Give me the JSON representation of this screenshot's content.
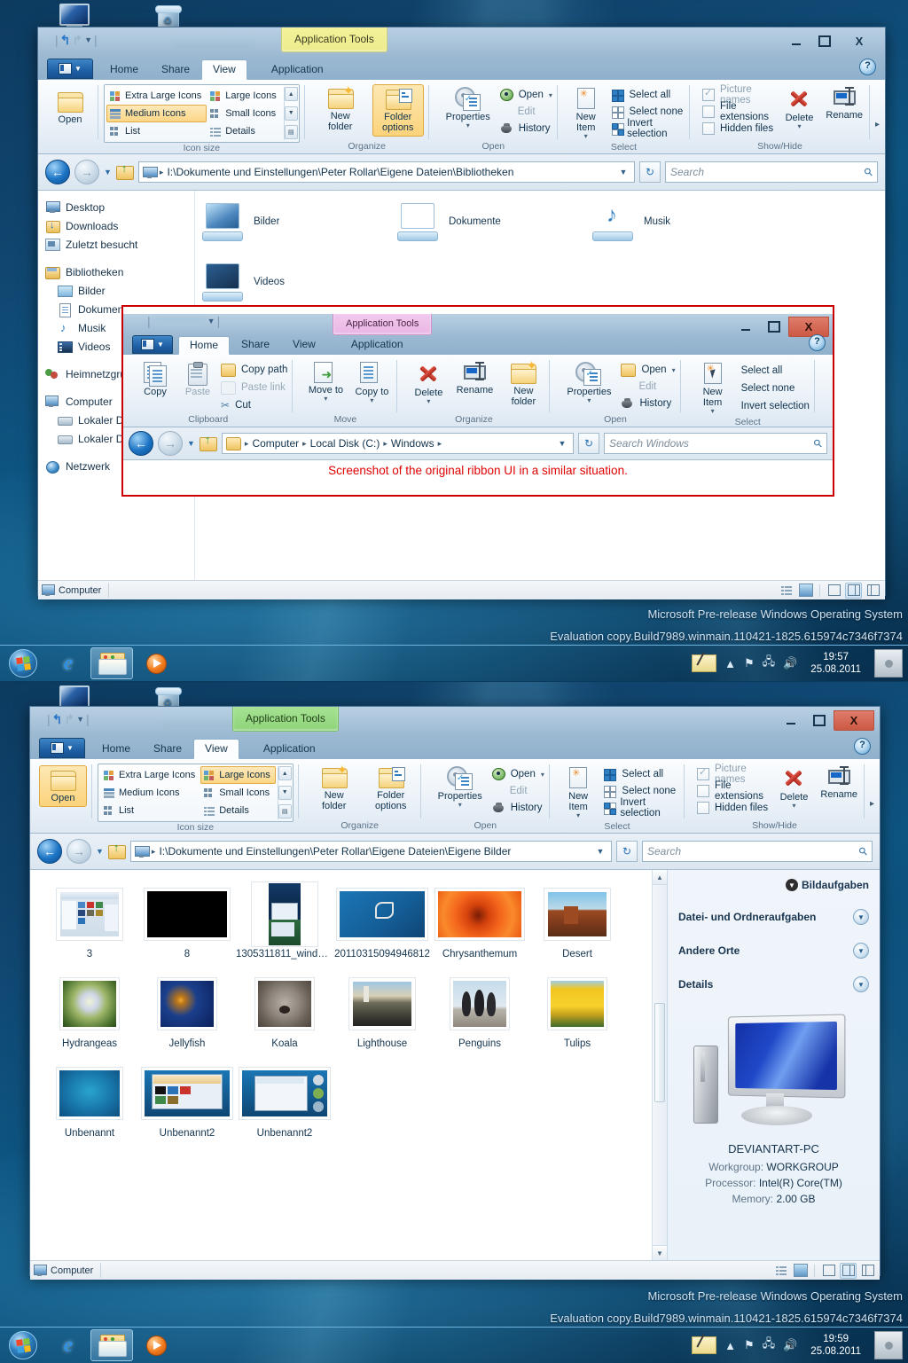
{
  "desktop": {
    "icons": [
      {
        "name": "Computer",
        "label": ""
      },
      {
        "name": "Recycle Bin",
        "label": ""
      }
    ],
    "watermark_line1": "Microsoft Pre-release Windows Operating System",
    "watermark_line2": "Evaluation copy.Build7989.winmain.110421-1825.615974c7346f7374"
  },
  "taskbar_top": {
    "start_label": "Start",
    "buttons": [
      "internet-explorer",
      "windows-explorer",
      "windows-media-player"
    ],
    "time": "19:57",
    "date": "25.08.2011"
  },
  "taskbar_bottom": {
    "start_label": "Start",
    "buttons": [
      "internet-explorer",
      "windows-explorer",
      "windows-media-player"
    ],
    "time": "19:59",
    "date": "25.08.2011"
  },
  "window_top": {
    "contextual_tab": "Application Tools",
    "contextual_tab_color": "#f0ee93",
    "tabs": [
      {
        "label": "Home",
        "selected": false
      },
      {
        "label": "Share",
        "selected": false
      },
      {
        "label": "View",
        "selected": true
      },
      {
        "label": "Application",
        "selected": false
      }
    ],
    "window_buttons": {
      "minimize": "–",
      "maximize": "□",
      "close": "X"
    },
    "help_tooltip": "Help",
    "ribbon": {
      "open_button": {
        "label": "Open",
        "highlighted": false
      },
      "groups": [
        {
          "title": "Icon size",
          "gallery": [
            {
              "label": "Extra Large Icons",
              "selected": false
            },
            {
              "label": "Medium Icons",
              "selected": true
            },
            {
              "label": "List",
              "selected": false
            },
            {
              "label": "Large Icons",
              "selected": false
            },
            {
              "label": "Small Icons",
              "selected": false
            },
            {
              "label": "Details",
              "selected": false
            }
          ]
        },
        {
          "title": "Organize",
          "buttons": [
            {
              "label": "New folder",
              "highlighted": false
            },
            {
              "label": "Folder options",
              "highlighted": true
            }
          ]
        },
        {
          "title": "Open",
          "buttons": [
            {
              "label": "Properties"
            }
          ],
          "small": [
            {
              "label": "Open"
            },
            {
              "label": "Edit",
              "disabled": true
            },
            {
              "label": "History"
            }
          ]
        },
        {
          "title": "Select",
          "buttons": [
            {
              "label": "New Item"
            }
          ],
          "small": [
            {
              "label": "Select all"
            },
            {
              "label": "Select none"
            },
            {
              "label": "Invert selection"
            }
          ]
        },
        {
          "title": "Show/Hide",
          "checkboxes": [
            {
              "label": "Picture names",
              "checked": true
            },
            {
              "label": "File extensions",
              "checked": false
            },
            {
              "label": "Hidden files",
              "checked": false
            }
          ],
          "buttons": [
            {
              "label": "Delete"
            },
            {
              "label": "Rename"
            }
          ]
        }
      ]
    },
    "address": "I:\\Dokumente und Einstellungen\\Peter Rollar\\Eigene Dateien\\Bibliotheken",
    "search_placeholder": "Search",
    "nav_pane": [
      {
        "label": "Desktop",
        "icon": "desktop-icon"
      },
      {
        "label": "Downloads",
        "icon": "downloads-icon"
      },
      {
        "label": "Zuletzt besucht",
        "icon": "recent-icon"
      },
      {
        "label": "Bibliotheken",
        "icon": "library-icon"
      },
      {
        "label": "Bilder",
        "icon": "pictures-icon"
      },
      {
        "label": "Dokumente",
        "icon": "documents-icon"
      },
      {
        "label": "Musik",
        "icon": "music-icon"
      },
      {
        "label": "Videos",
        "icon": "videos-icon"
      },
      {
        "label": "Heimnetzgruppe",
        "icon": "homegroup-icon"
      },
      {
        "label": "Computer",
        "icon": "computer-icon"
      },
      {
        "label": "Lokaler Datenträger",
        "icon": "drive-icon"
      },
      {
        "label": "Lokaler Datenträger",
        "icon": "drive-icon"
      },
      {
        "label": "Netzwerk",
        "icon": "network-icon"
      }
    ],
    "files": [
      {
        "name": "Bilder",
        "icon": "pictures-library"
      },
      {
        "name": "Dokumente",
        "icon": "documents-library"
      },
      {
        "name": "Musik",
        "icon": "music-library"
      },
      {
        "name": "Videos",
        "icon": "videos-library"
      }
    ],
    "status_text": "Computer"
  },
  "inset": {
    "caption": "Screenshot of the original ribbon UI in a similar situation.",
    "contextual_tab": "Application Tools",
    "tabs": [
      {
        "label": "Home",
        "selected": true
      },
      {
        "label": "Share",
        "selected": false
      },
      {
        "label": "View",
        "selected": false
      },
      {
        "label": "Application",
        "selected": false
      }
    ],
    "window_buttons": {
      "minimize": "–",
      "maximize": "□",
      "close": "X"
    },
    "groups": [
      {
        "title": "Clipboard",
        "big": [
          {
            "label": "Copy"
          },
          {
            "label": "Paste",
            "disabled": true
          }
        ],
        "small": [
          {
            "label": "Copy path",
            "disabled": false
          },
          {
            "label": "Paste link",
            "disabled": true
          },
          {
            "label": "Cut",
            "disabled": false
          }
        ]
      },
      {
        "title": "Move",
        "big": [
          {
            "label": "Move to"
          },
          {
            "label": "Copy to"
          }
        ]
      },
      {
        "title": "Organize",
        "big": [
          {
            "label": "Delete"
          },
          {
            "label": "Rename"
          },
          {
            "label": "New folder"
          }
        ]
      },
      {
        "title": "Open",
        "big": [
          {
            "label": "Properties"
          }
        ],
        "small": [
          {
            "label": "Open"
          },
          {
            "label": "Edit",
            "disabled": true
          },
          {
            "label": "History"
          }
        ]
      },
      {
        "title": "Select",
        "big": [
          {
            "label": "New Item"
          }
        ],
        "small": [
          {
            "label": "Select all"
          },
          {
            "label": "Select none"
          },
          {
            "label": "Invert selection"
          }
        ]
      }
    ],
    "breadcrumb": [
      "Computer",
      "Local Disk (C:)",
      "Windows"
    ],
    "search_placeholder": "Search Windows"
  },
  "window_bottom": {
    "contextual_tab": "Application Tools",
    "contextual_tab_color": "#93dc80",
    "tabs": [
      {
        "label": "Home",
        "selected": false
      },
      {
        "label": "Share",
        "selected": false
      },
      {
        "label": "View",
        "selected": true
      },
      {
        "label": "Application",
        "selected": false
      }
    ],
    "window_buttons": {
      "minimize": "–",
      "maximize": "□",
      "close": "X"
    },
    "ribbon": {
      "open_button": {
        "label": "Open",
        "highlighted": true
      },
      "groups": [
        {
          "title": "Icon size",
          "gallery": [
            {
              "label": "Extra Large Icons",
              "selected": false
            },
            {
              "label": "Medium Icons",
              "selected": false
            },
            {
              "label": "List",
              "selected": false
            },
            {
              "label": "Large Icons",
              "selected": true
            },
            {
              "label": "Small Icons",
              "selected": false
            },
            {
              "label": "Details",
              "selected": false
            }
          ]
        },
        {
          "title": "Organize",
          "buttons": [
            {
              "label": "New folder",
              "highlighted": false
            },
            {
              "label": "Folder options",
              "highlighted": false
            }
          ]
        },
        {
          "title": "Open",
          "buttons": [
            {
              "label": "Properties"
            }
          ],
          "small": [
            {
              "label": "Open"
            },
            {
              "label": "Edit",
              "disabled": true
            },
            {
              "label": "History"
            }
          ]
        },
        {
          "title": "Select",
          "buttons": [
            {
              "label": "New Item"
            }
          ],
          "small": [
            {
              "label": "Select all"
            },
            {
              "label": "Select none"
            },
            {
              "label": "Invert selection"
            }
          ]
        },
        {
          "title": "Show/Hide",
          "checkboxes": [
            {
              "label": "Picture names",
              "checked": true
            },
            {
              "label": "File extensions",
              "checked": false
            },
            {
              "label": "Hidden files",
              "checked": false
            }
          ],
          "buttons": [
            {
              "label": "Delete"
            },
            {
              "label": "Rename"
            }
          ]
        }
      ]
    },
    "address": "I:\\Dokumente und Einstellungen\\Peter Rollar\\Eigene Dateien\\Eigene Bilder",
    "search_placeholder": "Search",
    "files": [
      {
        "name": "3",
        "thumb": "explorer-screenshot"
      },
      {
        "name": "8",
        "thumb": "black"
      },
      {
        "name": "1305311811_windows...",
        "thumb": "windows-strip"
      },
      {
        "name": "20110315094946812",
        "thumb": "windows-logo"
      },
      {
        "name": "Chrysanthemum",
        "thumb": "chrysanthemum"
      },
      {
        "name": "Desert",
        "thumb": "desert"
      },
      {
        "name": "Hydrangeas",
        "thumb": "hydrangeas"
      },
      {
        "name": "Jellyfish",
        "thumb": "jellyfish"
      },
      {
        "name": "Koala",
        "thumb": "koala"
      },
      {
        "name": "Lighthouse",
        "thumb": "lighthouse"
      },
      {
        "name": "Penguins",
        "thumb": "penguins"
      },
      {
        "name": "Tulips",
        "thumb": "tulips"
      },
      {
        "name": "Unbenannt",
        "thumb": "blue-desktop"
      },
      {
        "name": "Unbenannt2",
        "thumb": "explorer-window"
      },
      {
        "name": "Unbenannt2",
        "thumb": "windows-dialog"
      }
    ],
    "right_pane": {
      "header": "Bildaufgaben",
      "sections": [
        "Datei- und Ordneraufgaben",
        "Andere Orte",
        "Details"
      ],
      "pc_name": "DEVIANTART-PC",
      "details": [
        {
          "key": "Workgroup:",
          "value": "WORKGROUP"
        },
        {
          "key": "Processor:",
          "value": "Intel(R) Core(TM)"
        },
        {
          "key": "Memory:",
          "value": "2.00 GB"
        }
      ]
    },
    "status_text": "Computer"
  }
}
